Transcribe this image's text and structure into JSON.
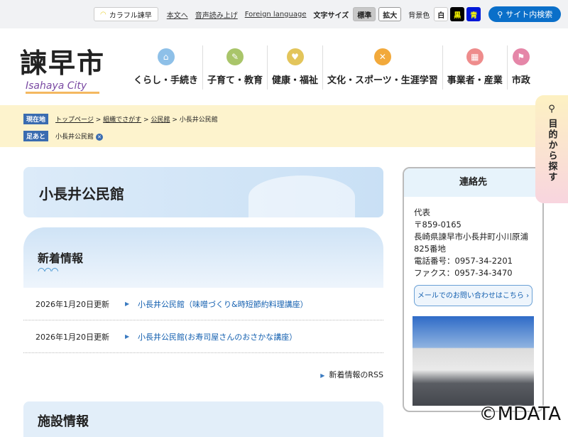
{
  "topbar": {
    "colorful": "カラフル諫早",
    "skip": "本文へ",
    "read_aloud": "音声読み上げ",
    "foreign": "Foreign language",
    "text_size_label": "文字サイズ",
    "size_standard": "標準",
    "size_large": "拡大",
    "bg_label": "背景色",
    "bg_white": "白",
    "bg_black": "黒",
    "bg_blue": "青",
    "search": "サイト内検索"
  },
  "logo": {
    "kanji": "諫早市",
    "en": "Isahaya City"
  },
  "gnav": [
    {
      "label": "くらし・手続き",
      "color": "#8ec0e8",
      "glyph": "⌂"
    },
    {
      "label": "子育て・教育",
      "color": "#a9c56a",
      "glyph": "✎"
    },
    {
      "label": "健康・福祉",
      "color": "#e3c55b",
      "glyph": "♥"
    },
    {
      "label": "文化・スポーツ・生涯学習",
      "color": "#f2a93b",
      "glyph": "✕"
    },
    {
      "label": "事業者・産業",
      "color": "#ee8c8c",
      "glyph": "▦"
    },
    {
      "label": "市政",
      "color": "#e586a8",
      "glyph": "⚑"
    }
  ],
  "breadcrumb": {
    "current_label": "現在地",
    "items": [
      "トップページ",
      "組織でさがす",
      "公民館"
    ],
    "current": "小長井公民館",
    "sep": ">",
    "footprint_label": "足あと",
    "footprint": "小長井公民館"
  },
  "page_title": "小長井公民館",
  "news": {
    "heading": "新着情報",
    "items": [
      {
        "date": "2026年1月20日更新",
        "title": "小長井公民館（味噌づくり&時短節約料理講座）"
      },
      {
        "date": "2026年1月20日更新",
        "title": "小長井公民館(お寿司屋さんのおさかな講座）"
      }
    ],
    "rss": "新着情報のRSS"
  },
  "facility_heading": "施設情報",
  "contact": {
    "heading": "連絡先",
    "lines": [
      "代表",
      "〒859-0165",
      "長崎県諫早市小長井町小川原浦825番地",
      "電話番号：0957-34-2201",
      "ファクス：0957-34-3470"
    ],
    "mail": "メールでのお問い合わせはこちら"
  },
  "float_tab": "目的から探す",
  "watermark": "©MDATA"
}
